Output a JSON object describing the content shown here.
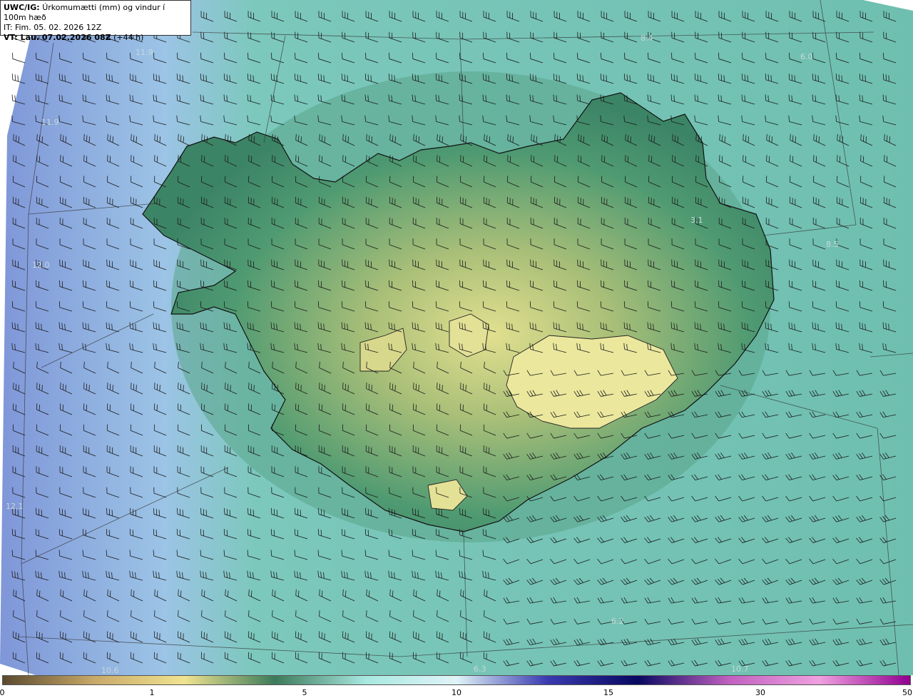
{
  "header": {
    "model": "UWC/IG:",
    "title": "Úrkomumætti (mm) og vindur í 100m hæð",
    "it_line": "IT: Fim. 05. 02. 2026 12Z",
    "vt_label": "VT: Lau. 07.02.2026 08Z",
    "vt_offset": "(+44 h)"
  },
  "point_labels": [
    "11.9",
    "11.9",
    "12.0",
    "12.1",
    "6.0",
    "3.1",
    "6.2",
    "6.3",
    "10.6",
    "10.7",
    "8.4",
    "8.5"
  ],
  "colorbar": {
    "ticks": [
      "0",
      "1",
      "5",
      "10",
      "15",
      "30",
      "50"
    ],
    "colors": [
      "#5a4a2e",
      "#c8a868",
      "#f0e490",
      "#3c7a5a",
      "#a8e8e0",
      "#e0f4f8",
      "#3a3ab0",
      "#080860",
      "#c060c0",
      "#f0a0e0",
      "#900090"
    ]
  },
  "map": {
    "colors": {
      "sea": "#6fbfb0",
      "land": "#4f9a72",
      "highland": "#c8cc80",
      "glacier": "#e6e49a",
      "west_sea": "#8fa8e0",
      "barb": "#1a1a1a",
      "coast": "#111111"
    }
  }
}
